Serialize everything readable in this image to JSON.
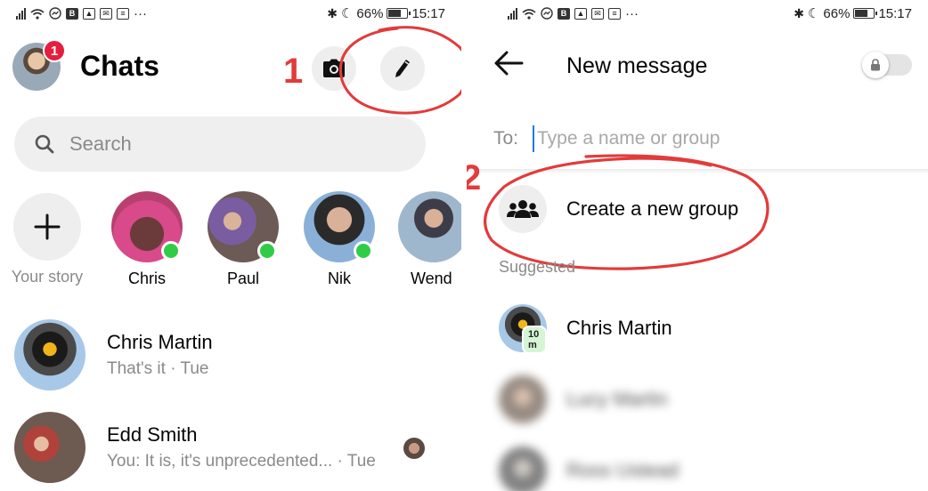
{
  "left": {
    "status": {
      "battery": "66%",
      "time": "15:17",
      "more": "···"
    },
    "header": {
      "title": "Chats",
      "badge_count": "1"
    },
    "search": {
      "placeholder": "Search"
    },
    "stories": [
      {
        "label": "Your story"
      },
      {
        "label": "Chris"
      },
      {
        "label": "Paul"
      },
      {
        "label": "Nik"
      },
      {
        "label": "Wend"
      }
    ],
    "chats": [
      {
        "name": "Chris Martin",
        "preview": "That's it · Tue"
      },
      {
        "name": "Edd Smith",
        "preview": "You: It is, it's unprecedented... · Tue"
      }
    ],
    "annotation": "1"
  },
  "right": {
    "status": {
      "battery": "66%",
      "time": "15:17",
      "more": "···"
    },
    "header": {
      "title": "New message"
    },
    "to": {
      "label": "To:",
      "placeholder": "Type a name or group"
    },
    "create_group": {
      "label": "Create a new group"
    },
    "section": "Suggested",
    "suggested": [
      {
        "name": "Chris Martin",
        "badge": "10 m"
      },
      {
        "name": "Lucy Martin"
      },
      {
        "name": "Ross Ustead"
      }
    ],
    "annotation": "2"
  },
  "colors": {
    "accent": "#1877f2",
    "online": "#31cc46",
    "badge": "#e41e3f",
    "annotation": "#e23b3b"
  }
}
